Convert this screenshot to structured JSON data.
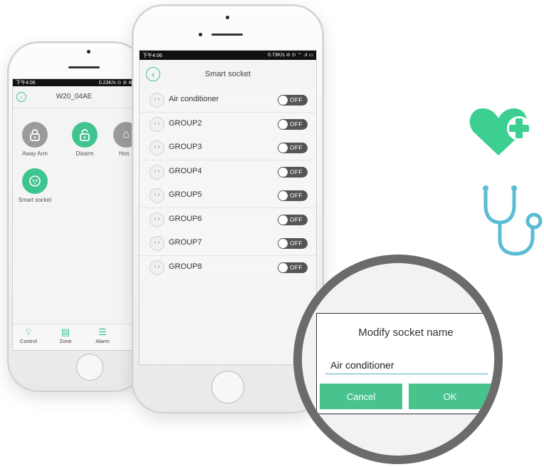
{
  "left_phone": {
    "status_time": "下午4:06",
    "status_right": "0.23K/s ⊙ ⊘ ⊚",
    "title": "W20_04AE",
    "tiles": [
      {
        "label": "Away Arm",
        "icon": "lock-icon",
        "color": "#9b9b9b"
      },
      {
        "label": "Disarm",
        "icon": "unlock-icon",
        "color": "#3fc490"
      },
      {
        "label": "Hon",
        "icon": "home-icon",
        "color": "#9b9b9b"
      },
      {
        "label": "Smart socket",
        "icon": "socket-icon",
        "color": "#3fc490"
      }
    ],
    "tabs": [
      {
        "label": "Control",
        "icon": "wifi-icon"
      },
      {
        "label": "Zone",
        "icon": "book-icon"
      },
      {
        "label": "Alarm",
        "icon": "list-icon"
      }
    ]
  },
  "right_phone": {
    "status_time": "下午4:06",
    "status_right": "0.73K/s ⊘ ⊙ ⌔ .ıl ▭",
    "title": "Smart socket",
    "rows": [
      {
        "label": "Air conditioner",
        "state": "OFF"
      },
      {
        "label": "GROUP2",
        "state": "OFF"
      },
      {
        "label": "GROUP3",
        "state": "OFF"
      },
      {
        "label": "GROUP4",
        "state": "OFF"
      },
      {
        "label": "GROUP5",
        "state": "OFF"
      },
      {
        "label": "GROUP6",
        "state": "OFF"
      },
      {
        "label": "GROUP7",
        "state": "OFF"
      },
      {
        "label": "GROUP8",
        "state": "OFF"
      }
    ]
  },
  "dialog": {
    "title": "Modify socket name",
    "input_value": "Air conditioner",
    "cancel_label": "Cancel",
    "ok_label": "OK"
  },
  "colors": {
    "accent": "#3fc490",
    "heart": "#3ccf91",
    "stethoscope": "#5bbcd6"
  }
}
